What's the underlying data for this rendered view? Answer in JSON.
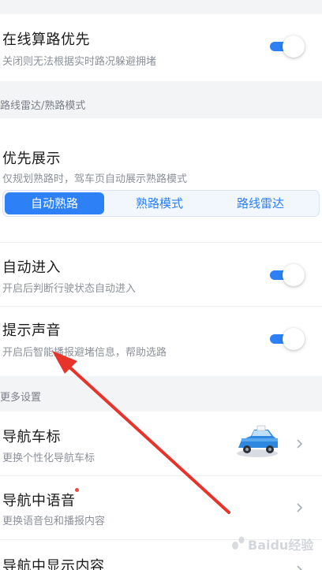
{
  "online_route": {
    "title": "在线算路优先",
    "subtitle": "关闭则无法根据实时路况躲避拥堵"
  },
  "section_radar": {
    "label": "路线雷达/熟路模式"
  },
  "priority_display": {
    "title": "优先展示",
    "subtitle": "仅规划熟路时，驾车页自动展示熟路模式",
    "options": [
      "自动熟路",
      "熟路模式",
      "路线雷达"
    ],
    "selected": "自动熟路"
  },
  "auto_enter": {
    "title": "自动进入",
    "subtitle": "开启后判断行驶状态自动进入"
  },
  "sound_prompt": {
    "title": "提示声音",
    "subtitle": "开启后智能播报避堵信息，帮助选路"
  },
  "section_more": {
    "label": "更多设置"
  },
  "nav_car_icon": {
    "title": "导航车标",
    "subtitle": "更换个性化导航车标"
  },
  "nav_voice": {
    "title": "导航中语音",
    "subtitle": "更换语音包和播报内容"
  },
  "nav_display": {
    "title": "导航中显示内容"
  },
  "watermark": {
    "text": "Baidu经验"
  },
  "colors": {
    "accent": "#2d80f6",
    "annotation": "#e8332a"
  }
}
